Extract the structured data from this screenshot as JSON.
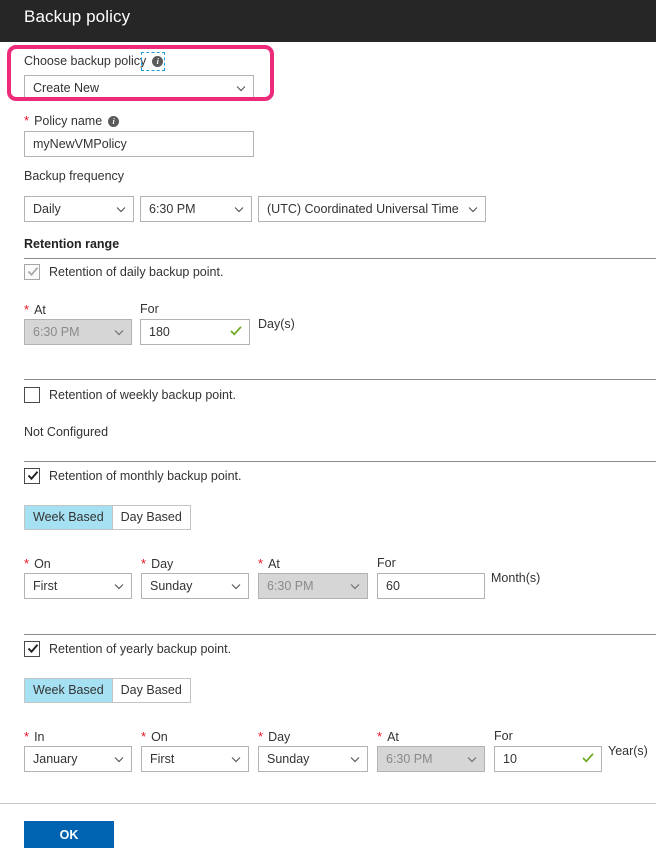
{
  "header": {
    "title": "Backup policy"
  },
  "choose_policy": {
    "label": "Choose backup policy",
    "info_icon": "info-icon",
    "value": "Create New",
    "highlight_color": "#ee2a7b",
    "focus_color": "#1ba1e2"
  },
  "policy_name": {
    "label": "Policy name",
    "required": "*",
    "info_icon": "info-icon",
    "value": "myNewVMPolicy",
    "placeholder": "Policy name"
  },
  "backup_frequency": {
    "label": "Backup frequency",
    "frequency": "Daily",
    "time": "6:30 PM",
    "timezone": "(UTC) Coordinated Universal Time"
  },
  "retention_range": {
    "title": "Retention range",
    "daily": {
      "checkbox_label": "Retention of daily backup point.",
      "checked": "true",
      "disabled": "true",
      "at_label": "At",
      "at_value": "6:30 PM",
      "for_label": "For",
      "for_value": "180",
      "unit": "Day(s)",
      "valid_icon": "check-icon"
    },
    "weekly": {
      "checkbox_label": "Retention of weekly backup point.",
      "checked": "false",
      "not_configured": "Not Configured"
    },
    "monthly": {
      "checkbox_label": "Retention of monthly backup point.",
      "checked": "true",
      "tab_week": "Week Based",
      "tab_day": "Day Based",
      "selected_tab": "Week Based",
      "on_label": "On",
      "on_value": "First",
      "day_label": "Day",
      "day_value": "Sunday",
      "at_label": "At",
      "at_value": "6:30 PM",
      "for_label": "For",
      "for_value": "60",
      "unit": "Month(s)"
    },
    "yearly": {
      "checkbox_label": "Retention of yearly backup point.",
      "checked": "true",
      "tab_week": "Week Based",
      "tab_day": "Day Based",
      "selected_tab": "Week Based",
      "in_label": "In",
      "in_value": "January",
      "on_label": "On",
      "on_value": "First",
      "day_label": "Day",
      "day_value": "Sunday",
      "at_label": "At",
      "at_value": "6:30 PM",
      "for_label": "For",
      "for_value": "10",
      "unit": "Year(s)",
      "valid_icon": "check-icon"
    }
  },
  "footer": {
    "ok_label": "OK",
    "ok_color": "#0063b1"
  }
}
